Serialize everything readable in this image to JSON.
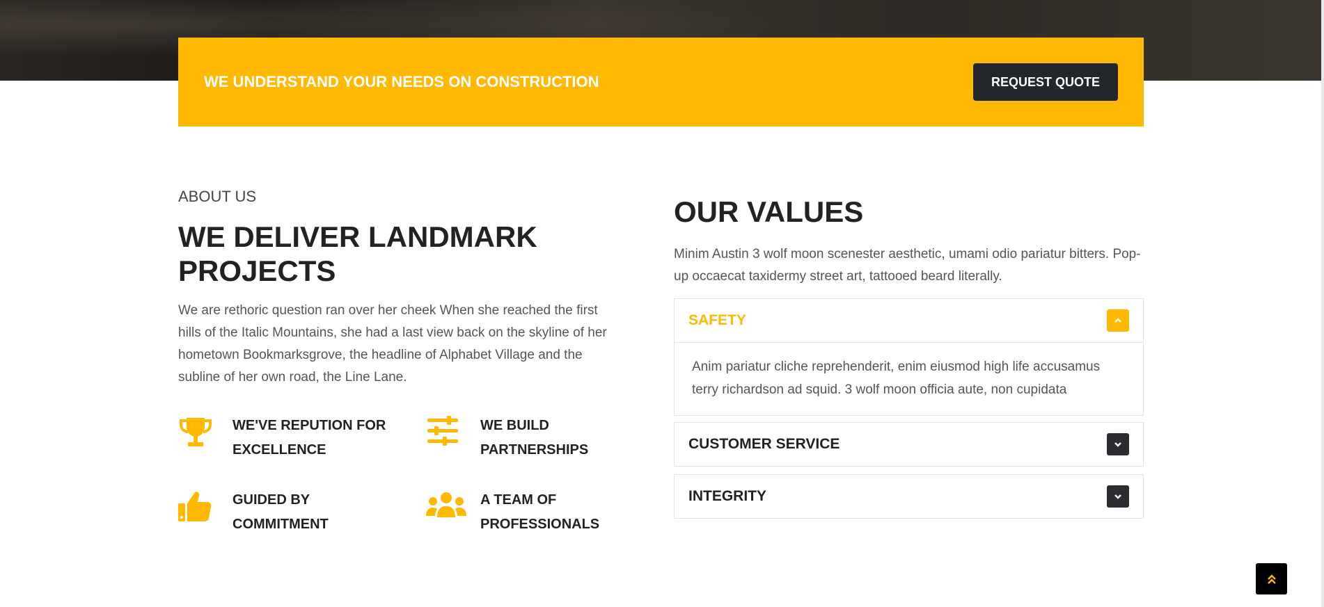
{
  "colors": {
    "accent": "#ffb902",
    "dark": "#23262b",
    "text": "#222222",
    "muted": "#555555"
  },
  "cta": {
    "title": "WE UNDERSTAND YOUR NEEDS ON CONSTRUCTION",
    "button_label": "REQUEST QUOTE"
  },
  "about": {
    "subtitle": "ABOUT US",
    "title": "WE DELIVER LANDMARK PROJECTS",
    "text": "We are rethoric question ran over her cheek When she reached the first hills of the Italic Mountains, she had a last view back on the skyline of her hometown Bookmarksgrove, the headline of Alphabet Village and the subline of her own road, the Line Lane."
  },
  "features": [
    {
      "icon": "trophy-icon",
      "line1": "WE'VE REPUTION FOR",
      "line2": "EXCELLENCE"
    },
    {
      "icon": "sliders-icon",
      "line1": "WE BUILD",
      "line2": "PARTNERSHIPS"
    },
    {
      "icon": "thumbs-up-icon",
      "line1": "GUIDED BY",
      "line2": "COMMITMENT"
    },
    {
      "icon": "users-icon",
      "line1": "A TEAM OF",
      "line2": "PROFESSIONALS"
    }
  ],
  "values": {
    "title": "OUR VALUES",
    "text": "Minim Austin 3 wolf moon scenester aesthetic, umami odio pariatur bitters. Pop-up occaecat taxidermy street art, tattooed beard literally.",
    "accordion": [
      {
        "title": "SAFETY",
        "open": true,
        "body": "Anim pariatur cliche reprehenderit, enim eiusmod high life accusamus terry richardson ad squid. 3 wolf moon officia aute, non cupidata"
      },
      {
        "title": "CUSTOMER SERVICE",
        "open": false
      },
      {
        "title": "INTEGRITY",
        "open": false
      }
    ]
  },
  "scroll_top": {
    "icon": "double-chevron-up-icon"
  }
}
